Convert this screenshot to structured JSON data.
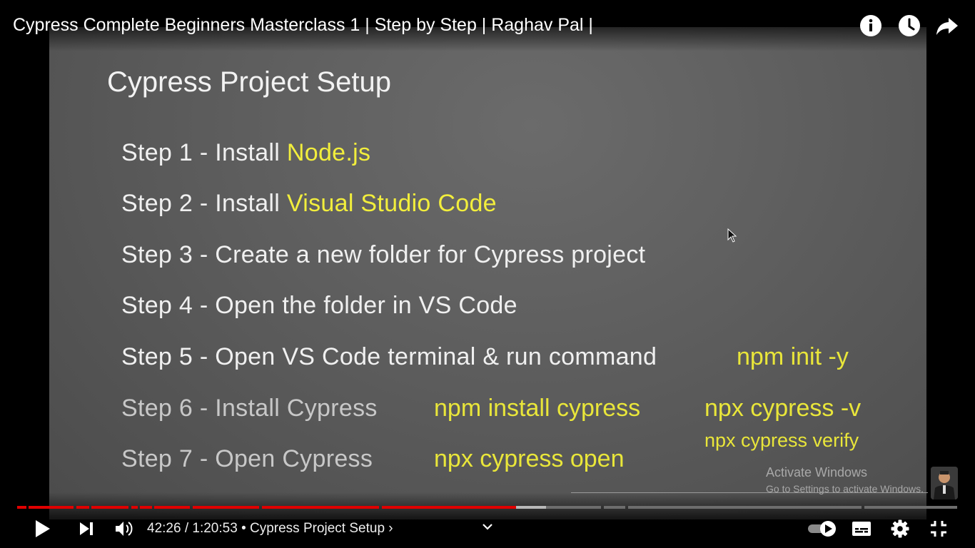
{
  "video": {
    "title": "Cypress Complete Beginners Masterclass 1 | Step by Step | Raghav Pal |",
    "top_icons": [
      "info-icon",
      "watch-later-icon",
      "share-icon"
    ]
  },
  "slide": {
    "heading": "Cypress Project Setup",
    "steps": [
      {
        "prefix": "Step 1 - Install ",
        "highlight": "Node.js"
      },
      {
        "prefix": "Step 2 - Install ",
        "highlight": "Visual Studio Code"
      },
      {
        "prefix": "Step 3 - Create a new folder for Cypress project",
        "highlight": ""
      },
      {
        "prefix": "Step 4 - Open the folder in VS Code",
        "highlight": ""
      },
      {
        "prefix": "Step 5 - Open VS Code terminal & run command",
        "highlight": ""
      },
      {
        "prefix": "Step 6 - Install Cypress",
        "highlight": ""
      },
      {
        "prefix": "Step 7 - Open Cypress",
        "highlight": ""
      }
    ],
    "commands": {
      "step5": "npm init -y",
      "step6_install": "npm install cypress",
      "step6_version": "npx cypress -v",
      "step6_verify": "npx cypress verify",
      "step7": "npx cypress open"
    },
    "highlight_color": "#f2ee3c"
  },
  "watermark": {
    "line1": "Activate Windows",
    "line2": "Go to Settings to activate Windows."
  },
  "player": {
    "current_time": "42:26",
    "duration": "1:20:53",
    "time_display": "42:26 / 1:20:53",
    "chapter": "• Cypress Project Setup ›",
    "played_fraction": 0.531,
    "buffered_fraction": 0.563,
    "accent_color": "#e00000",
    "controls": [
      "play-icon",
      "next-icon",
      "volume-icon",
      "chapters-chevron-icon",
      "autoplay-toggle",
      "subtitles-icon",
      "settings-icon",
      "exit-fullscreen-icon"
    ]
  }
}
